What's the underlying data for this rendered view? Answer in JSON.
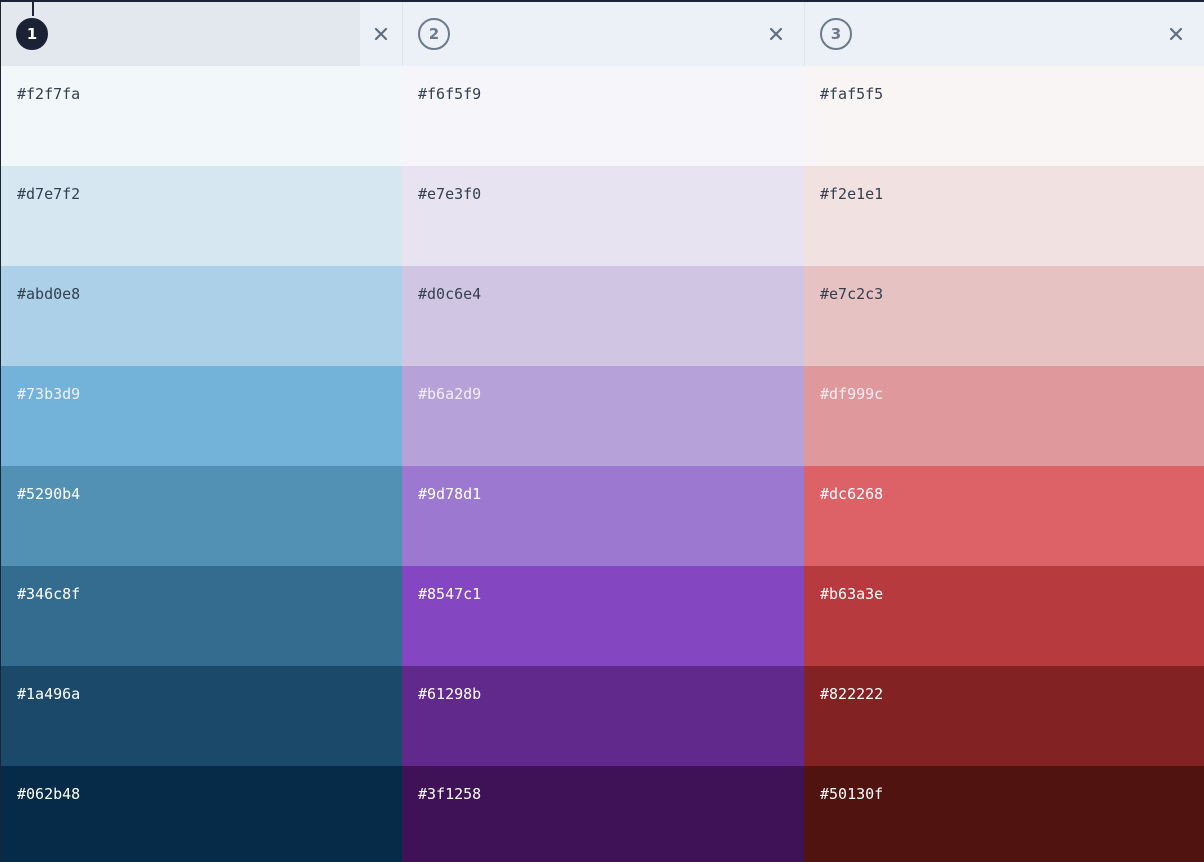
{
  "colors": {
    "dark_text": "#33404f",
    "light_text": "#ffffff",
    "faded_text": "#f3eef6",
    "close_icon": "#5f6d7e"
  },
  "columns": [
    {
      "number": "1",
      "active": true,
      "close_icon": "close-icon",
      "swatches": [
        {
          "hex": "#f2f7fa",
          "text": "dark"
        },
        {
          "hex": "#d7e7f2",
          "text": "dark"
        },
        {
          "hex": "#abd0e8",
          "text": "dark"
        },
        {
          "hex": "#73b3d9",
          "text": "faded"
        },
        {
          "hex": "#5290b4",
          "text": "light"
        },
        {
          "hex": "#346c8f",
          "text": "light"
        },
        {
          "hex": "#1a496a",
          "text": "light"
        },
        {
          "hex": "#062b48",
          "text": "light"
        }
      ]
    },
    {
      "number": "2",
      "active": false,
      "close_icon": "close-icon",
      "swatches": [
        {
          "hex": "#f6f5f9",
          "text": "dark"
        },
        {
          "hex": "#e7e3f0",
          "text": "dark"
        },
        {
          "hex": "#d0c6e4",
          "text": "dark"
        },
        {
          "hex": "#b6a2d9",
          "text": "faded"
        },
        {
          "hex": "#9d78d1",
          "text": "light"
        },
        {
          "hex": "#8547c1",
          "text": "light"
        },
        {
          "hex": "#61298b",
          "text": "light"
        },
        {
          "hex": "#3f1258",
          "text": "light"
        }
      ]
    },
    {
      "number": "3",
      "active": false,
      "close_icon": "close-icon",
      "swatches": [
        {
          "hex": "#faf5f5",
          "text": "dark"
        },
        {
          "hex": "#f2e1e1",
          "text": "dark"
        },
        {
          "hex": "#e7c2c3",
          "text": "dark"
        },
        {
          "hex": "#df999c",
          "text": "faded"
        },
        {
          "hex": "#dc6268",
          "text": "light"
        },
        {
          "hex": "#b63a3e",
          "text": "light"
        },
        {
          "hex": "#822222",
          "text": "light"
        },
        {
          "hex": "#50130f",
          "text": "light"
        }
      ]
    }
  ]
}
